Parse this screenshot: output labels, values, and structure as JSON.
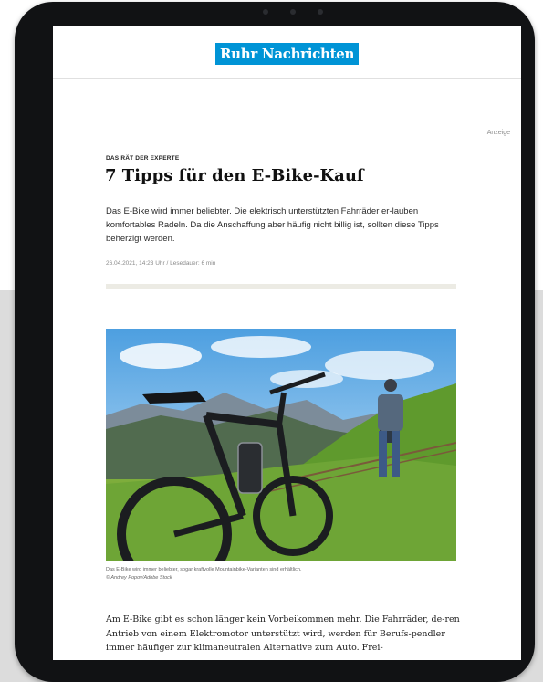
{
  "site": {
    "logo_text": "Ruhr Nachrichten",
    "brand_color": "#0094d6"
  },
  "article": {
    "ad_label": "Anzeige",
    "kicker": "DAS RÄT DER EXPERTE",
    "headline": "7 Tipps für den E-Bike-Kauf",
    "teaser": "Das E-Bike wird immer beliebter. Die elektrisch unterstützten Fahrräder er-lauben komfortables Radeln. Da die Anschaffung aber häufig nicht billig ist, sollten diese Tipps beherzigt werden.",
    "meta": "26.04.2021, 14:23 Uhr / Lesedauer: 6 min",
    "image": {
      "caption": "Das E-Bike wird immer beliebter, sogar kraftvolle Mountainbike-Varianten sind erhältlich.",
      "credit": "© Andrey Popov/Adobe Stock"
    },
    "body_intro": "Am E-Bike gibt es schon länger kein Vorbeikommen mehr. Die Fahrräder, de-ren Antrieb von einem Elektromotor unterstützt wird, werden für Berufs-pendler immer häufiger zur klimaneutralen Alternative zum Auto. Frei-"
  }
}
